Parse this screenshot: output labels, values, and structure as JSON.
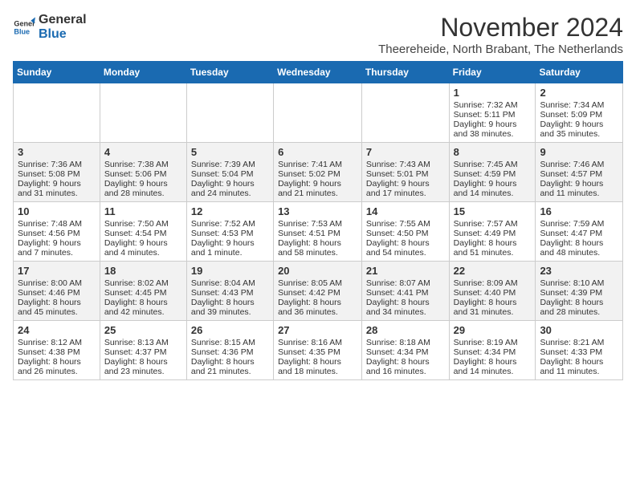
{
  "header": {
    "logo_general": "General",
    "logo_blue": "Blue",
    "month_title": "November 2024",
    "subtitle": "Theereheide, North Brabant, The Netherlands"
  },
  "weekdays": [
    "Sunday",
    "Monday",
    "Tuesday",
    "Wednesday",
    "Thursday",
    "Friday",
    "Saturday"
  ],
  "weeks": [
    [
      {
        "day": "",
        "content": ""
      },
      {
        "day": "",
        "content": ""
      },
      {
        "day": "",
        "content": ""
      },
      {
        "day": "",
        "content": ""
      },
      {
        "day": "",
        "content": ""
      },
      {
        "day": "1",
        "content": "Sunrise: 7:32 AM\nSunset: 5:11 PM\nDaylight: 9 hours and 38 minutes."
      },
      {
        "day": "2",
        "content": "Sunrise: 7:34 AM\nSunset: 5:09 PM\nDaylight: 9 hours and 35 minutes."
      }
    ],
    [
      {
        "day": "3",
        "content": "Sunrise: 7:36 AM\nSunset: 5:08 PM\nDaylight: 9 hours and 31 minutes."
      },
      {
        "day": "4",
        "content": "Sunrise: 7:38 AM\nSunset: 5:06 PM\nDaylight: 9 hours and 28 minutes."
      },
      {
        "day": "5",
        "content": "Sunrise: 7:39 AM\nSunset: 5:04 PM\nDaylight: 9 hours and 24 minutes."
      },
      {
        "day": "6",
        "content": "Sunrise: 7:41 AM\nSunset: 5:02 PM\nDaylight: 9 hours and 21 minutes."
      },
      {
        "day": "7",
        "content": "Sunrise: 7:43 AM\nSunset: 5:01 PM\nDaylight: 9 hours and 17 minutes."
      },
      {
        "day": "8",
        "content": "Sunrise: 7:45 AM\nSunset: 4:59 PM\nDaylight: 9 hours and 14 minutes."
      },
      {
        "day": "9",
        "content": "Sunrise: 7:46 AM\nSunset: 4:57 PM\nDaylight: 9 hours and 11 minutes."
      }
    ],
    [
      {
        "day": "10",
        "content": "Sunrise: 7:48 AM\nSunset: 4:56 PM\nDaylight: 9 hours and 7 minutes."
      },
      {
        "day": "11",
        "content": "Sunrise: 7:50 AM\nSunset: 4:54 PM\nDaylight: 9 hours and 4 minutes."
      },
      {
        "day": "12",
        "content": "Sunrise: 7:52 AM\nSunset: 4:53 PM\nDaylight: 9 hours and 1 minute."
      },
      {
        "day": "13",
        "content": "Sunrise: 7:53 AM\nSunset: 4:51 PM\nDaylight: 8 hours and 58 minutes."
      },
      {
        "day": "14",
        "content": "Sunrise: 7:55 AM\nSunset: 4:50 PM\nDaylight: 8 hours and 54 minutes."
      },
      {
        "day": "15",
        "content": "Sunrise: 7:57 AM\nSunset: 4:49 PM\nDaylight: 8 hours and 51 minutes."
      },
      {
        "day": "16",
        "content": "Sunrise: 7:59 AM\nSunset: 4:47 PM\nDaylight: 8 hours and 48 minutes."
      }
    ],
    [
      {
        "day": "17",
        "content": "Sunrise: 8:00 AM\nSunset: 4:46 PM\nDaylight: 8 hours and 45 minutes."
      },
      {
        "day": "18",
        "content": "Sunrise: 8:02 AM\nSunset: 4:45 PM\nDaylight: 8 hours and 42 minutes."
      },
      {
        "day": "19",
        "content": "Sunrise: 8:04 AM\nSunset: 4:43 PM\nDaylight: 8 hours and 39 minutes."
      },
      {
        "day": "20",
        "content": "Sunrise: 8:05 AM\nSunset: 4:42 PM\nDaylight: 8 hours and 36 minutes."
      },
      {
        "day": "21",
        "content": "Sunrise: 8:07 AM\nSunset: 4:41 PM\nDaylight: 8 hours and 34 minutes."
      },
      {
        "day": "22",
        "content": "Sunrise: 8:09 AM\nSunset: 4:40 PM\nDaylight: 8 hours and 31 minutes."
      },
      {
        "day": "23",
        "content": "Sunrise: 8:10 AM\nSunset: 4:39 PM\nDaylight: 8 hours and 28 minutes."
      }
    ],
    [
      {
        "day": "24",
        "content": "Sunrise: 8:12 AM\nSunset: 4:38 PM\nDaylight: 8 hours and 26 minutes."
      },
      {
        "day": "25",
        "content": "Sunrise: 8:13 AM\nSunset: 4:37 PM\nDaylight: 8 hours and 23 minutes."
      },
      {
        "day": "26",
        "content": "Sunrise: 8:15 AM\nSunset: 4:36 PM\nDaylight: 8 hours and 21 minutes."
      },
      {
        "day": "27",
        "content": "Sunrise: 8:16 AM\nSunset: 4:35 PM\nDaylight: 8 hours and 18 minutes."
      },
      {
        "day": "28",
        "content": "Sunrise: 8:18 AM\nSunset: 4:34 PM\nDaylight: 8 hours and 16 minutes."
      },
      {
        "day": "29",
        "content": "Sunrise: 8:19 AM\nSunset: 4:34 PM\nDaylight: 8 hours and 14 minutes."
      },
      {
        "day": "30",
        "content": "Sunrise: 8:21 AM\nSunset: 4:33 PM\nDaylight: 8 hours and 11 minutes."
      }
    ]
  ]
}
